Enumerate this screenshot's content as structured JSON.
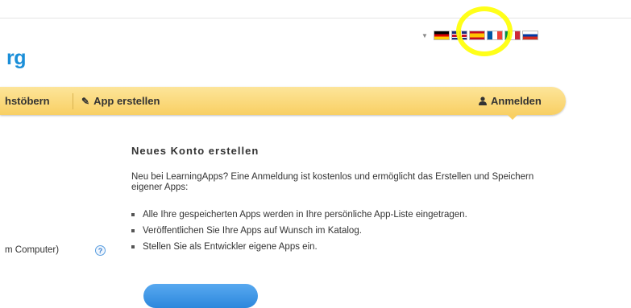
{
  "logo": {
    "text": "rg"
  },
  "language_bar": {
    "toggle_icon": "triangle-down-icon",
    "flags": [
      "de",
      "en",
      "es",
      "fr",
      "it",
      "ru"
    ]
  },
  "annotation": {
    "color": "#ffff00"
  },
  "nav": {
    "browse_label": "hstöbern",
    "create_label": "App erstellen",
    "create_icon": "pencil-icon",
    "login_label": "Anmelden",
    "login_icon": "user-icon"
  },
  "panel": {
    "title": "Neues Konto erstellen",
    "intro": "Neu bei LearningApps? Eine Anmeldung ist kostenlos und ermöglicht das Erstellen und Speichern eigener Apps:",
    "benefits": [
      "Alle Ihre gespeicherten Apps werden in Ihre persönliche App-Liste eingetragen.",
      "Veröffentlichen Sie Ihre Apps auf Wunsch im Katalog.",
      "Stellen Sie als Entwickler eigene Apps ein."
    ]
  },
  "left_form": {
    "label": "m Computer)",
    "help_icon": "?"
  },
  "colors": {
    "brand_blue": "#1a8ed8",
    "nav_yellow": "#f8cf63"
  }
}
